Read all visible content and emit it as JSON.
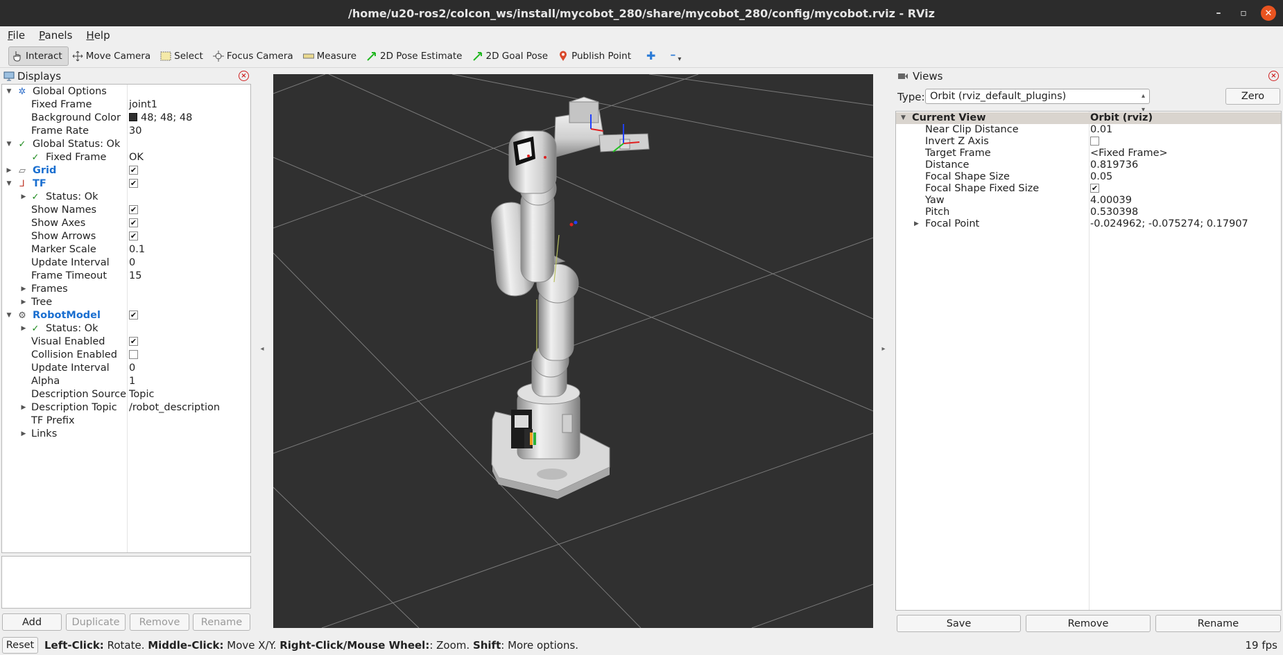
{
  "window": {
    "title": "/home/u20-ros2/colcon_ws/install/mycobot_280/share/mycobot_280/config/mycobot.rviz - RViz",
    "minimize_glyph": "–",
    "maximize_glyph": "▫",
    "close_glyph": "✕"
  },
  "menu": [
    "File",
    "Panels",
    "Help"
  ],
  "toolbar": {
    "tools": [
      {
        "label": "Interact",
        "icon": "hand-pointer-icon",
        "active": true
      },
      {
        "label": "Move Camera",
        "icon": "move-camera-icon"
      },
      {
        "label": "Select",
        "icon": "select-box-icon"
      },
      {
        "label": "Focus Camera",
        "icon": "focus-camera-icon"
      },
      {
        "label": "Measure",
        "icon": "ruler-icon"
      },
      {
        "label": "2D Pose Estimate",
        "icon": "green-arrow-icon"
      },
      {
        "label": "2D Goal Pose",
        "icon": "green-arrow-icon"
      },
      {
        "label": "Publish Point",
        "icon": "map-pin-icon"
      }
    ],
    "add_glyph": "✚",
    "remove_glyph": "━",
    "dropdown_glyph": "▾"
  },
  "displays": {
    "title": "Displays",
    "close_glyph": "×",
    "global_options": {
      "label": "Global Options",
      "fixed_frame": {
        "label": "Fixed Frame",
        "value": "joint1"
      },
      "background_color": {
        "label": "Background Color",
        "value": "48; 48; 48",
        "swatch": "#303030"
      },
      "frame_rate": {
        "label": "Frame Rate",
        "value": "30"
      }
    },
    "global_status": {
      "label": "Global Status: Ok",
      "fixed_frame": {
        "label": "Fixed Frame",
        "value": "OK"
      }
    },
    "grid": {
      "label": "Grid",
      "checked": true
    },
    "tf": {
      "label": "TF",
      "checked": true,
      "status": "Status: Ok",
      "show_names": {
        "label": "Show Names",
        "checked": true
      },
      "show_axes": {
        "label": "Show Axes",
        "checked": true
      },
      "show_arrows": {
        "label": "Show Arrows",
        "checked": true
      },
      "marker_scale": {
        "label": "Marker Scale",
        "value": "0.1"
      },
      "update_interval": {
        "label": "Update Interval",
        "value": "0"
      },
      "frame_timeout": {
        "label": "Frame Timeout",
        "value": "15"
      },
      "frames": "Frames",
      "tree": "Tree"
    },
    "robot_model": {
      "label": "RobotModel",
      "checked": true,
      "status": "Status: Ok",
      "visual_enabled": {
        "label": "Visual Enabled",
        "checked": true
      },
      "collision_enabled": {
        "label": "Collision Enabled",
        "checked": false
      },
      "update_interval": {
        "label": "Update Interval",
        "value": "0"
      },
      "alpha": {
        "label": "Alpha",
        "value": "1"
      },
      "description_source": {
        "label": "Description Source",
        "value": "Topic"
      },
      "description_topic": {
        "label": "Description Topic",
        "value": "/robot_description"
      },
      "tf_prefix": {
        "label": "TF Prefix",
        "value": ""
      },
      "links": "Links"
    },
    "buttons": {
      "add": "Add",
      "duplicate": "Duplicate",
      "remove": "Remove",
      "rename": "Rename"
    }
  },
  "views": {
    "title": "Views",
    "close_glyph": "×",
    "type_label": "Type:",
    "type_value": "Orbit (rviz_default_plugins)",
    "zero": "Zero",
    "current_view": {
      "label": "Current View",
      "value": "Orbit (rviz)"
    },
    "props": {
      "near_clip": {
        "label": "Near Clip Distance",
        "value": "0.01"
      },
      "invert_z": {
        "label": "Invert Z Axis",
        "checked": false
      },
      "target_frame": {
        "label": "Target Frame",
        "value": "<Fixed Frame>"
      },
      "distance": {
        "label": "Distance",
        "value": "0.819736"
      },
      "focal_size": {
        "label": "Focal Shape Size",
        "value": "0.05"
      },
      "focal_fixed": {
        "label": "Focal Shape Fixed Size",
        "checked": true
      },
      "yaw": {
        "label": "Yaw",
        "value": "4.00039"
      },
      "pitch": {
        "label": "Pitch",
        "value": "0.530398"
      },
      "focal_point": {
        "label": "Focal Point",
        "value": "-0.024962; -0.075274; 0.17907"
      }
    },
    "buttons": {
      "save": "Save",
      "remove": "Remove",
      "rename": "Rename"
    }
  },
  "status": {
    "reset": "Reset",
    "k1": "Left-Click:",
    "t1": " Rotate. ",
    "k2": "Middle-Click:",
    "t2": " Move X/Y. ",
    "k3": "Right-Click/Mouse Wheel:",
    "t3": ": Zoom. ",
    "k4": "Shift",
    "t4": ": More options.",
    "fps": "19 fps"
  },
  "glyphs": {
    "expanded": "▼",
    "collapsed": "▶",
    "check": "✓",
    "check_mark": "✔",
    "split_left": "◂",
    "split_right": "▸"
  }
}
